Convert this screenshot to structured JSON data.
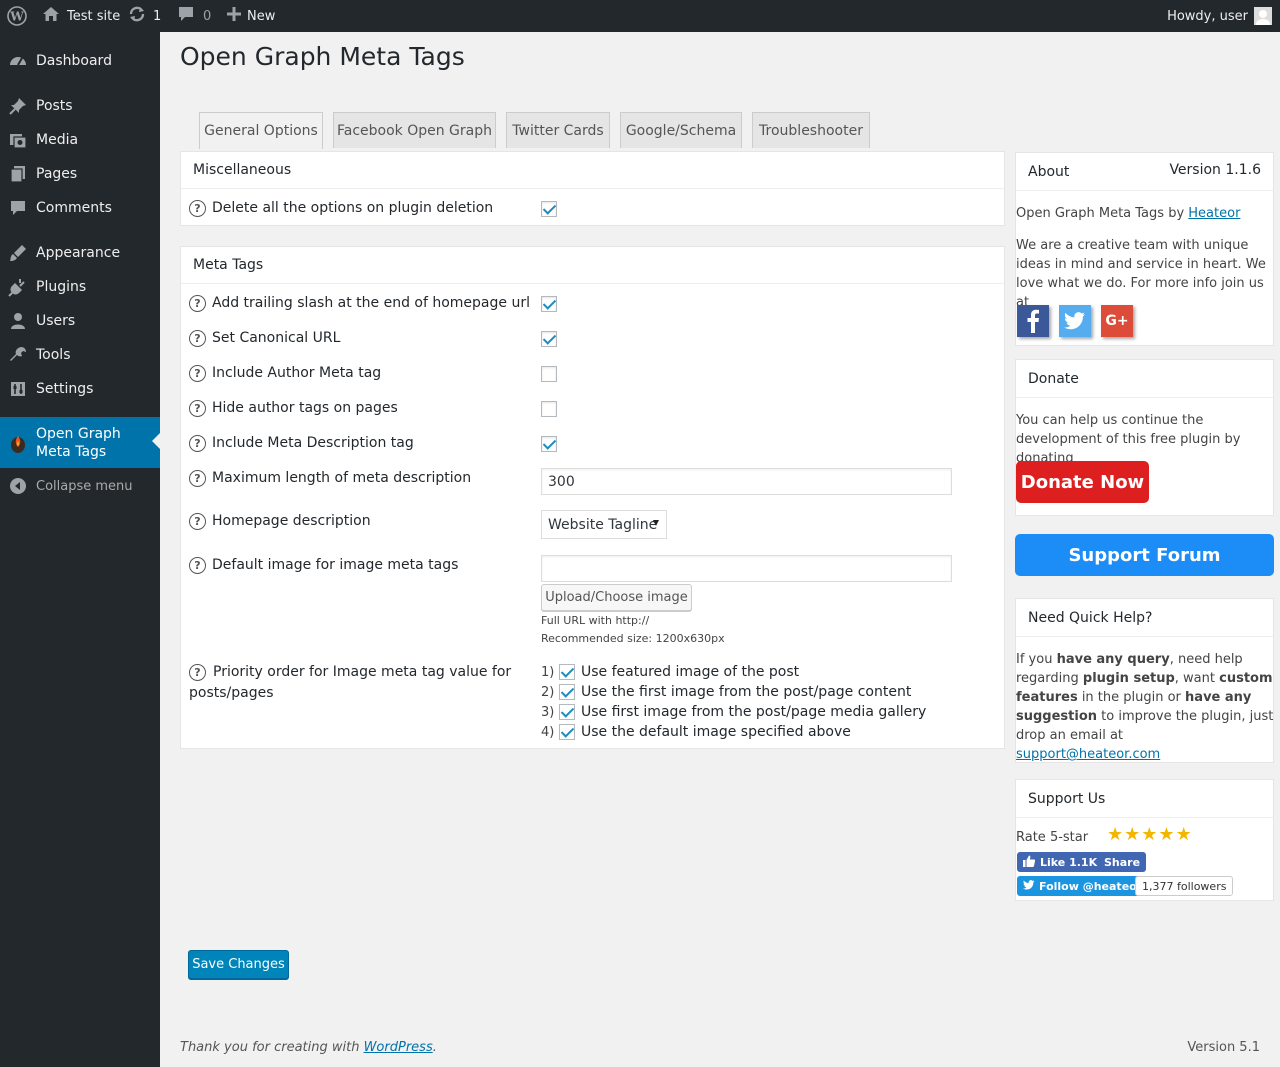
{
  "admin_bar": {
    "site_name": "Test site",
    "updates_count": "1",
    "comments_count": "0",
    "new_label": "New",
    "howdy": "Howdy, user"
  },
  "sidebar": {
    "items": [
      {
        "label": "Dashboard",
        "icon": "dashboard-icon"
      },
      {
        "label": "Posts",
        "icon": "pin-icon"
      },
      {
        "label": "Media",
        "icon": "media-icon"
      },
      {
        "label": "Pages",
        "icon": "page-icon"
      },
      {
        "label": "Comments",
        "icon": "comment-icon"
      },
      {
        "label": "Appearance",
        "icon": "brush-icon"
      },
      {
        "label": "Plugins",
        "icon": "plug-icon"
      },
      {
        "label": "Users",
        "icon": "user-icon"
      },
      {
        "label": "Tools",
        "icon": "wrench-icon"
      },
      {
        "label": "Settings",
        "icon": "sliders-icon"
      },
      {
        "label": "Open Graph Meta Tags",
        "icon": "plugin-logo-icon"
      }
    ],
    "collapse": "Collapse menu"
  },
  "page": {
    "title": "Open Graph Meta Tags",
    "tabs": [
      "General Options",
      "Facebook Open Graph",
      "Twitter Cards",
      "Google/Schema",
      "Troubleshooter"
    ]
  },
  "misc": {
    "title": "Miscellaneous",
    "delete_label": "Delete all the options on plugin deletion",
    "delete_checked": true
  },
  "meta": {
    "title": "Meta Tags",
    "rows": [
      {
        "label": "Add trailing slash at the end of homepage url",
        "checked": true
      },
      {
        "label": "Set Canonical URL",
        "checked": true
      },
      {
        "label": "Include Author Meta tag",
        "checked": false
      },
      {
        "label": "Hide author tags on pages",
        "checked": false
      },
      {
        "label": "Include Meta Description tag",
        "checked": true
      }
    ],
    "max_length_label": "Maximum length of meta description",
    "max_length_value": "300",
    "homepage_desc_label": "Homepage description",
    "homepage_desc_value": "Website Tagline",
    "default_image_label": "Default image for image meta tags",
    "default_image_value": "",
    "upload_button": "Upload/Choose image",
    "note_url": "Full URL with http://",
    "note_size": "Recommended size: 1200x630px",
    "priority_label": "Priority order for Image meta tag value for posts/pages",
    "priority": [
      {
        "num": "1)",
        "label": "Use featured image of the post",
        "checked": true
      },
      {
        "num": "2)",
        "label": "Use the first image from the post/page content",
        "checked": true
      },
      {
        "num": "3)",
        "label": "Use first image from the post/page media gallery",
        "checked": true
      },
      {
        "num": "4)",
        "label": "Use the default image specified above",
        "checked": true
      }
    ]
  },
  "save_button": "Save Changes",
  "footer": {
    "thanks_prefix": "Thank you for creating with ",
    "thanks_link": "WordPress",
    "thanks_suffix": ".",
    "version": "Version 5.1"
  },
  "about": {
    "title": "About",
    "version": "Version 1.1.6",
    "by_prefix": "Open Graph Meta Tags",
    "by_word": " by ",
    "by_link": "Heateor",
    "description": "We are a creative team with unique ideas in mind and service in heart. We love what we do. For more info join us at",
    "social": [
      "facebook-icon",
      "twitter-icon",
      "google-plus-icon"
    ],
    "google_label": "G+"
  },
  "donate": {
    "title": "Donate",
    "text": "You can help us continue the development of this free plugin by donating",
    "button": "Donate Now"
  },
  "support_forum": "Support Forum",
  "quick_help": {
    "title": "Need Quick Help?",
    "p1": "If you ",
    "b1": "have any query",
    "p2": ", need help regarding ",
    "b2": "plugin setup",
    "p3": ", want ",
    "b3": "custom features",
    "p4": " in the plugin or ",
    "b4": "have any suggestion",
    "p5": " to improve the plugin, just drop an email at",
    "email": "support@heateor.com"
  },
  "support_us": {
    "title": "Support Us",
    "rate_label": "Rate 5-star",
    "stars": 5,
    "like_label": "Like 1.1K",
    "share_label": "Share",
    "follow_label": "Follow @heateor",
    "followers": "1,377 followers"
  },
  "colors": {
    "admin_dark": "#23282d",
    "accent": "#0073aa",
    "donate_red": "#dd1f1f",
    "forum_blue": "#1c8cf6"
  }
}
